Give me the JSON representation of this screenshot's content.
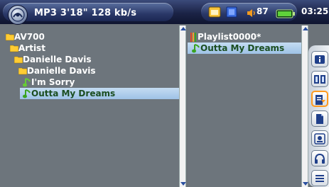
{
  "status_bar": {
    "track_info": "MP3 3'18\" 128 kb/s",
    "volume": "87",
    "clock": "03:25"
  },
  "left_panel": {
    "rows": [
      {
        "label": "AV700",
        "icon": "folder-icon",
        "selected": false
      },
      {
        "label": "Artist",
        "icon": "folder-icon",
        "selected": false
      },
      {
        "label": "Danielle Davis",
        "icon": "folder-icon",
        "selected": false
      },
      {
        "label": "Danielle Davis",
        "icon": "folder-icon",
        "selected": false
      },
      {
        "label": "I'm Sorry",
        "icon": "music-note-icon",
        "selected": false
      },
      {
        "label": "Outta My Dreams",
        "icon": "music-note-icon",
        "selected": true
      }
    ]
  },
  "right_panel": {
    "rows": [
      {
        "label": "Playlist0000*",
        "icon": "playlist-icon",
        "selected": false
      },
      {
        "label": "Outta My Dreams",
        "icon": "music-note-icon",
        "selected": true
      }
    ]
  },
  "toolbar": {
    "buttons": [
      {
        "name": "info-icon",
        "active": false
      },
      {
        "name": "browser-icon",
        "active": false
      },
      {
        "name": "add-to-playlist-icon",
        "active": true
      },
      {
        "name": "file-icon",
        "active": false
      },
      {
        "name": "settings-icon",
        "active": false
      },
      {
        "name": "headphones-icon",
        "active": false
      },
      {
        "name": "menu-icon",
        "active": false
      }
    ]
  },
  "colors": {
    "selection": "#a8c8ec",
    "selected_text": "#1a4d20",
    "panel_bg": "#6d757c",
    "folder": "#ffcc33",
    "music_note": "#66cc33",
    "active_border": "#ff9a1f"
  }
}
